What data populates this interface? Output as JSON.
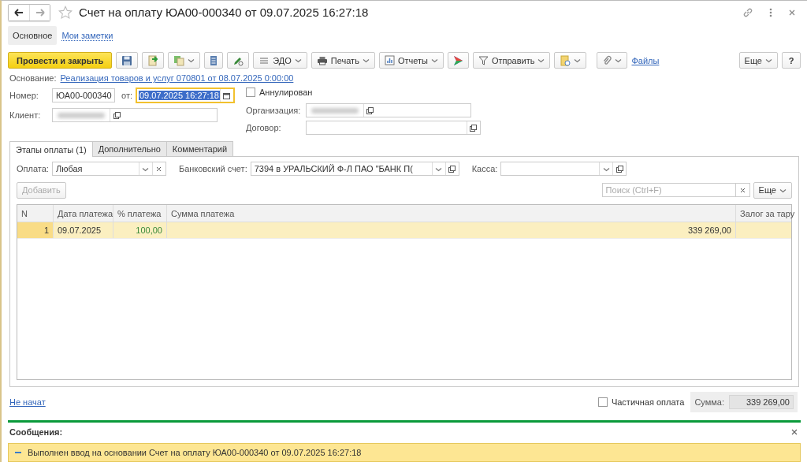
{
  "window": {
    "title": "Счет на оплату ЮА00-000340 от 09.07.2025 16:27:18",
    "favorite": false
  },
  "sections": [
    {
      "label": "Основное",
      "selected": true
    },
    {
      "label": "Мои заметки",
      "selected": false
    }
  ],
  "toolbar": {
    "primary": "Провести и закрыть",
    "edo": "ЭДО",
    "print": "Печать",
    "reports": "Отчеты",
    "send": "Отправить",
    "files": "Файлы",
    "more": "Еще",
    "help": "?"
  },
  "basis": {
    "label": "Основание:",
    "link": "Реализация товаров и услуг 070801 от 08.07.2025 0:00:00"
  },
  "number": {
    "label": "Номер:",
    "value": "ЮА00-000340"
  },
  "date": {
    "label": "от:",
    "value": "09.07.2025 16:27:18"
  },
  "cancelled": {
    "label": "Аннулирован",
    "checked": false
  },
  "client": {
    "label": "Клиент:"
  },
  "organization": {
    "label": "Организация:"
  },
  "contract": {
    "label": "Договор:"
  },
  "tabs": [
    {
      "label": "Этапы оплаты (1)",
      "selected": true
    },
    {
      "label": "Дополнительно",
      "selected": false
    },
    {
      "label": "Комментарий",
      "selected": false
    }
  ],
  "payment": {
    "label": "Оплата:",
    "value": "Любая"
  },
  "bank": {
    "label": "Банковский счет:",
    "value": "7394 в УРАЛЬСКИЙ Ф-Л ПАО \"БАНК П("
  },
  "cash": {
    "label": "Касса:"
  },
  "add_button": {
    "label": "Добавить",
    "disabled": true
  },
  "search": {
    "placeholder": "Поиск (Ctrl+F)"
  },
  "table_more": "Еще",
  "table": {
    "columns": [
      "N",
      "Дата платежа",
      "% платежа",
      "Сумма платежа",
      "Залог за тару"
    ],
    "rows": [
      {
        "cells": [
          "1",
          "09.07.2025",
          "100,00",
          "339 269,00",
          ""
        ],
        "selected": true
      }
    ]
  },
  "status_link": "Не начат",
  "partial": {
    "label": "Частичная оплата",
    "checked": false
  },
  "sum": {
    "label": "Сумма:",
    "value": "339 269,00"
  },
  "messages": {
    "title": "Сообщения:",
    "items": [
      "Выполнен ввод на основании Счет на оплату ЮА00-000340 от 09.07.2025 16:27:18"
    ]
  }
}
